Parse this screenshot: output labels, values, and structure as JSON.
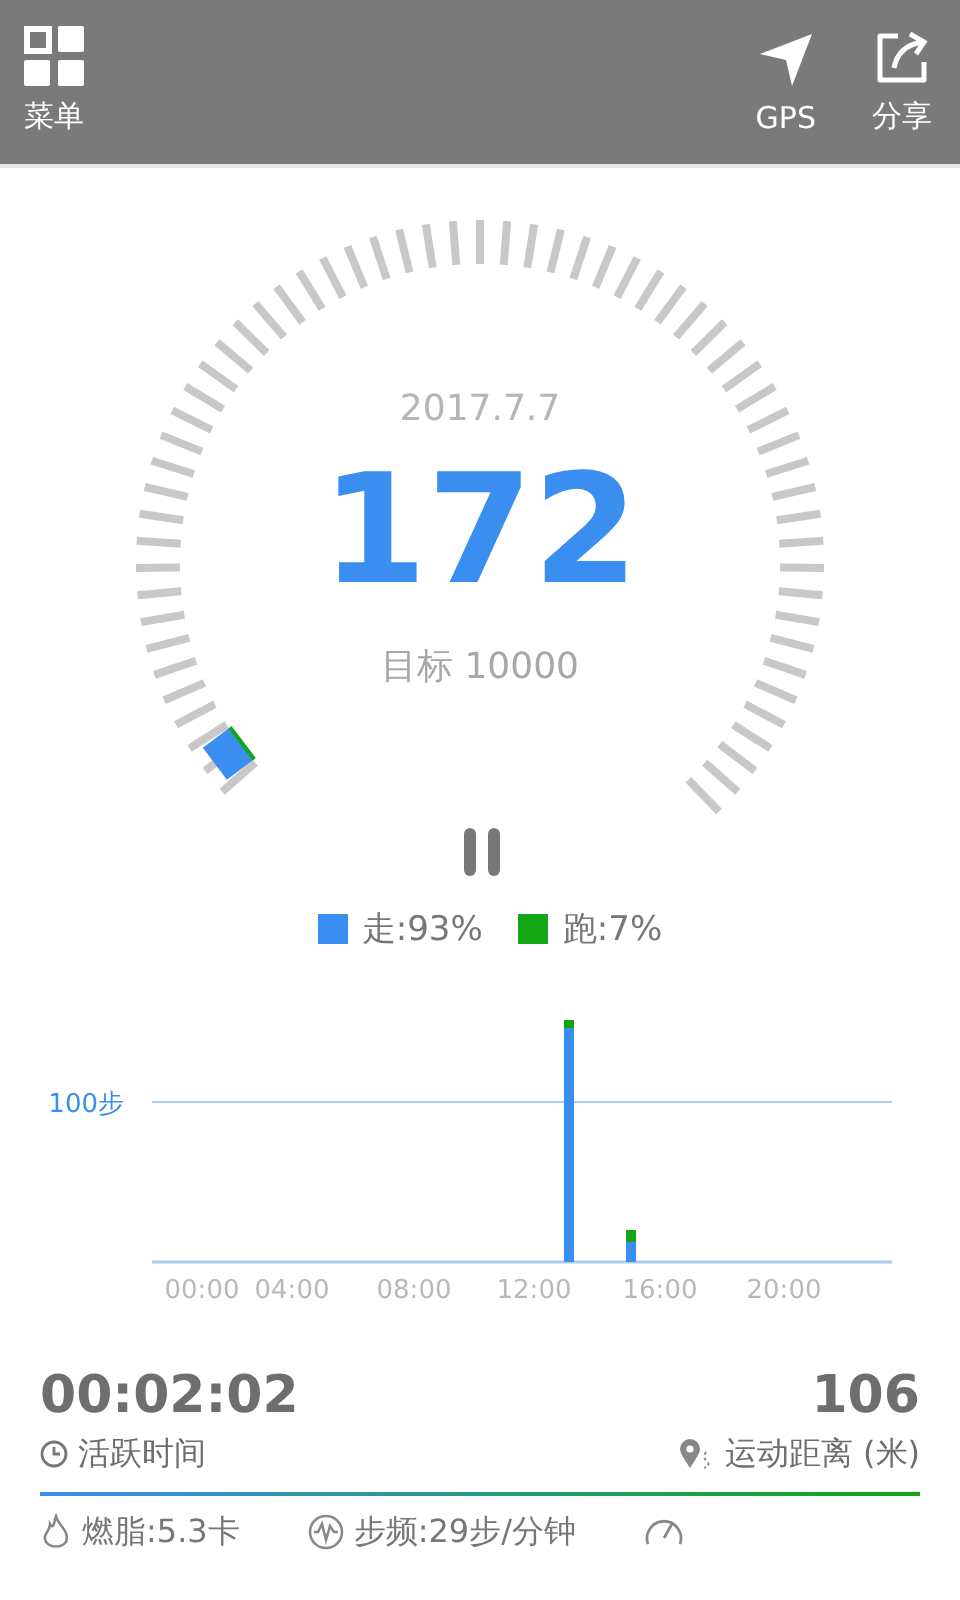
{
  "header": {
    "menu_label": "菜单",
    "gps_label": "GPS",
    "share_label": "分享"
  },
  "gauge": {
    "date": "2017.7.7",
    "steps": "172",
    "target": "目标 10000"
  },
  "legend": [
    {
      "label": "走:93%",
      "color": "#3a8ef0"
    },
    {
      "label": "跑:7%",
      "color": "#12a612"
    }
  ],
  "chart": {
    "y_label": "100步",
    "x_labels": [
      "00:00",
      "04:00",
      "08:00",
      "12:00",
      "16:00",
      "20:00"
    ]
  },
  "stats": {
    "time": "00:02:02",
    "time_label": "活跃时间",
    "distance": "106",
    "distance_label": "运动距离 (米)",
    "metrics": [
      {
        "kind": "calories",
        "text": "燃脂:5.3卡"
      },
      {
        "kind": "cadence",
        "text": "步频:29步/分钟"
      },
      {
        "kind": "pace"
      }
    ]
  }
}
